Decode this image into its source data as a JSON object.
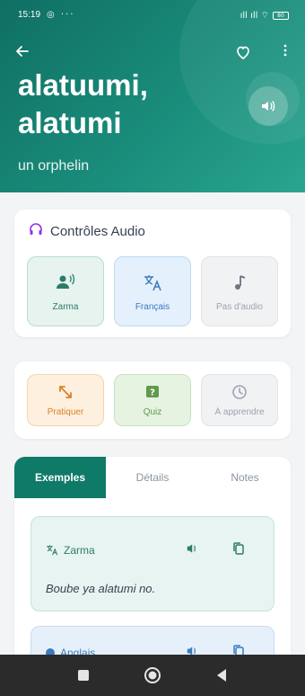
{
  "status_bar": {
    "time": "15:19",
    "left_icons": "◎ ···",
    "signal_icons": "ıll ıll ⌔",
    "battery": "80"
  },
  "header": {
    "word": "alatuumi, alatumi",
    "translation": "un orphelin",
    "back_icon": "arrow-left",
    "favorite_icon": "heart-outline",
    "menu_icon": "more-vertical",
    "speak_icon": "volume",
    "background": "#1b8f7d"
  },
  "audio_controls": {
    "title": "Contrôles Audio",
    "buttons": [
      {
        "label": "Zarma",
        "icon": "person-voice",
        "color": "#2c7c6b"
      },
      {
        "label": "Français",
        "icon": "translate",
        "color": "#3a7bbf"
      },
      {
        "label": "Pas d'audio",
        "icon": "music-note",
        "color": "#9ca3af"
      }
    ]
  },
  "actions": [
    {
      "label": "Pratiquer",
      "icon": "expand",
      "color": "#d9822b"
    },
    {
      "label": "Quiz",
      "icon": "quiz",
      "color": "#5f9a4f"
    },
    {
      "label": "À apprendre",
      "icon": "clock",
      "color": "#9ca3af"
    }
  ],
  "tabs": [
    {
      "label": "Exemples",
      "active": true
    },
    {
      "label": "Détails",
      "active": false
    },
    {
      "label": "Notes",
      "active": false
    }
  ],
  "examples": [
    {
      "language": "Zarma",
      "sentence": "Boube ya alatumi no."
    },
    {
      "language": "Anglais",
      "sentence": ""
    }
  ],
  "nav_bar": {
    "recent_icon": "square",
    "home_icon": "circle",
    "back_icon": "triangle-left"
  }
}
